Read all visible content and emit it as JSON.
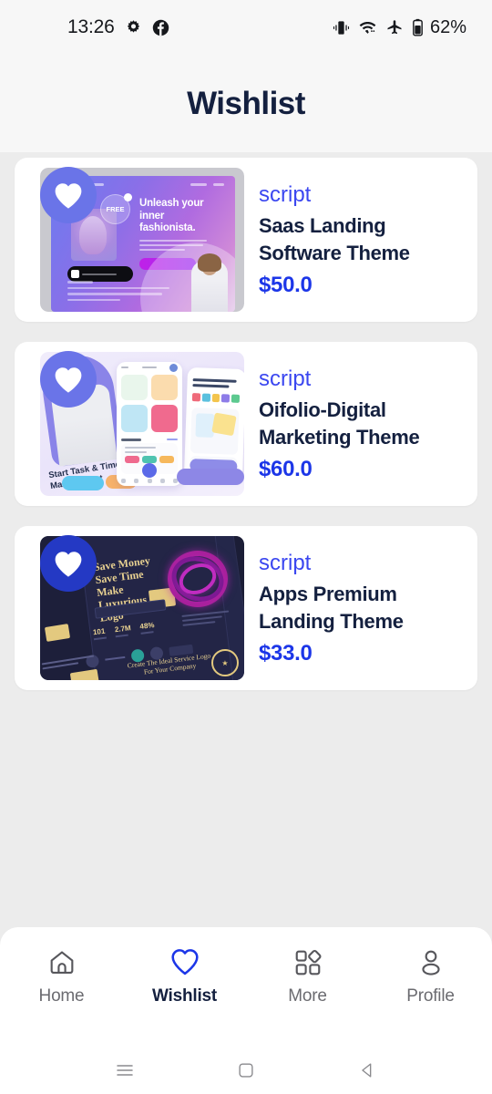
{
  "status_bar": {
    "time": "13:26",
    "left_icons": [
      "settings-gear-icon",
      "facebook-icon"
    ],
    "right_icons": [
      "vibrate-icon",
      "wifi-icon",
      "airplane-mode-icon",
      "battery-icon"
    ],
    "battery": "62%"
  },
  "header": {
    "title": "Wishlist"
  },
  "theme": {
    "page_bg": "#ececec",
    "header_bg": "#f7f7f7",
    "card_bg": "#ffffff",
    "title_color": "#14203f",
    "category_color": "#3b47f0",
    "price_color": "#1c36e8",
    "nav_active_color": "#1c36e8",
    "nav_inactive_color": "#6b6b70"
  },
  "products": [
    {
      "category": "script",
      "title": "Saas Landing Software Theme",
      "price": "$50.0",
      "favorite": true,
      "badge_color": "#6a74e8",
      "thumbnail": "saas-landing-purple-gradient-tablet-mockup",
      "thumb_text": {
        "headline": "Unleash your inner fashionista.",
        "badge": "FREE"
      }
    },
    {
      "category": "script",
      "title": "Oifolio-Digital Marketing Theme",
      "price": "$60.0",
      "favorite": true,
      "badge_color": "#6a74e8",
      "thumbnail": "oifolio-three-phone-mockups-lavender",
      "thumb_text": {
        "headline": "Start Task & Time Management"
      }
    },
    {
      "category": "script",
      "title": "Apps Premium Landing Theme",
      "price": "$33.0",
      "favorite": true,
      "badge_color": "#2439c4",
      "thumbnail": "apps-premium-dark-navy-gold-mockup",
      "thumb_text": {
        "headline": "Save Money Save Time Make Luxurious Logo",
        "footer": "Create The Ideal Service Logo For Your Company"
      }
    }
  ],
  "bottom_nav": {
    "items": [
      {
        "label": "Home",
        "icon": "home-icon",
        "active": false
      },
      {
        "label": "Wishlist",
        "icon": "heart-icon",
        "active": true
      },
      {
        "label": "More",
        "icon": "grid-shapes-icon",
        "active": false
      },
      {
        "label": "Profile",
        "icon": "person-icon",
        "active": false
      }
    ]
  },
  "system_nav": {
    "items": [
      {
        "name": "recents-button",
        "icon": "hamburger-icon"
      },
      {
        "name": "home-button",
        "icon": "square-icon"
      },
      {
        "name": "back-button",
        "icon": "triangle-left-icon"
      }
    ]
  }
}
